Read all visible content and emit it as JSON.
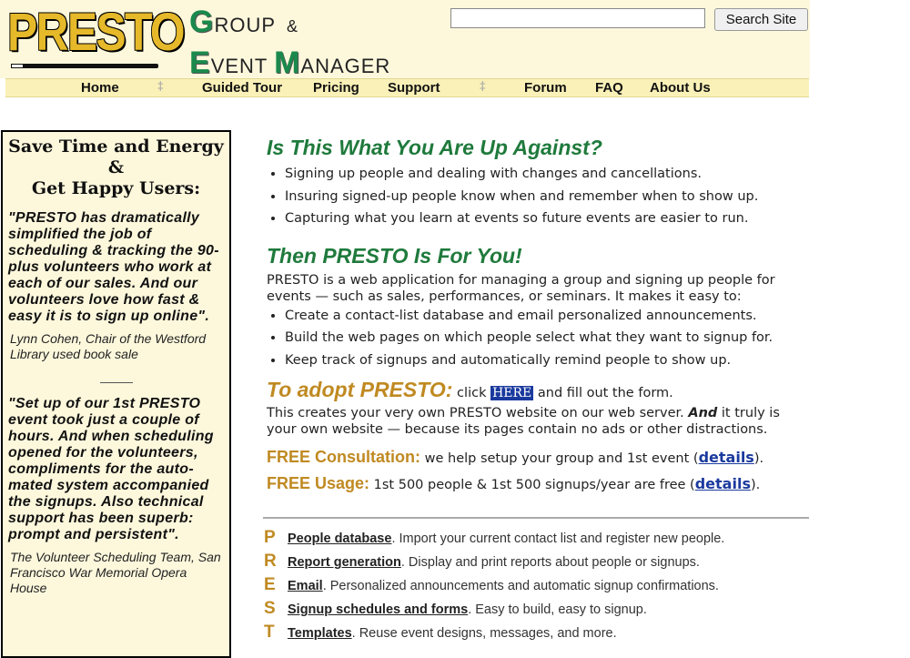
{
  "header": {
    "logo_text": "PRESTO",
    "tagline": [
      {
        "cap": "G",
        "rest": "ROUP",
        "amp": "&"
      },
      {
        "cap": "E",
        "rest": "VENT ",
        "cap2": "M",
        "rest2": "ANAGER"
      }
    ],
    "search_placeholder": "",
    "search_button": "Search Site"
  },
  "nav": [
    {
      "label": "Home"
    },
    {
      "label": "Guided Tour"
    },
    {
      "label": "Pricing"
    },
    {
      "label": "Support"
    },
    {
      "label": "Forum"
    },
    {
      "label": "FAQ"
    },
    {
      "label": "About Us"
    }
  ],
  "nav_separator": "‡",
  "sidebar": {
    "heading_line1": "Save Time and Energy",
    "heading_line2": "&",
    "heading_line3": "Get Happy Users:",
    "quote1": "\"PRESTO has dramatically simplified the job of scheduling & tracking the 90-plus volunteers who work at each of our sales. And our volunteers love how fast & easy it is to sign up online\".",
    "attrib1": "Lynn Cohen, Chair of the Westford Library used book sale",
    "quote2": "\"Set up of our 1st PRESTO event took just a couple of hours. And when scheduling opened for the volunteers, compliments for the auto-mated system accompanied the signups. Also technical support has been superb: prompt and persistent\".",
    "attrib2": "The Volunteer Scheduling Team, San Francisco War Memorial Opera House"
  },
  "main": {
    "h_against": "Is This What You Are Up Against?",
    "against_items": [
      "Signing up people and dealing with changes and cancellations.",
      "Insuring signed-up people know when and remember when to show up.",
      "Capturing what you learn at events so future events are easier to run."
    ],
    "h_foryou": "Then PRESTO Is For You!",
    "intro": "PRESTO is a web application for managing a group and signing up people for events — such as sales, performances, or seminars. It makes it easy to:",
    "foryou_items": [
      "Create a contact-list database and email personalized announcements.",
      "Build the web pages on which people select what they want to signup for.",
      "Keep track of signups and automatically remind people to show up."
    ],
    "adopt_heading": "To adopt PRESTO:",
    "adopt_click": " click ",
    "adopt_here": "HERE",
    "adopt_rest": " and fill out the form.",
    "adopt_para_1": "This creates your very own PRESTO website on our web server. ",
    "adopt_para_and": "And",
    "adopt_para_2": " it truly is your own website — because its pages contain no ads or other distractions.",
    "consult_heading": "FREE Consultation:",
    "consult_text": " we help setup your group and 1st event (",
    "usage_heading": "FREE Usage:",
    "usage_text": " 1st 500 people & 1st 500 signups/year are free (",
    "details_label": "details",
    "close_paren": ")."
  },
  "features": [
    {
      "letter": "P",
      "link": "People database",
      "desc": ". Import your current contact list and register new people."
    },
    {
      "letter": "R",
      "link": "Report generation",
      "desc": ". Display and print reports about people or signups."
    },
    {
      "letter": "E",
      "link": "Email",
      "desc": ". Personalized announcements and automatic signup confirmations."
    },
    {
      "letter": "S",
      "link": "Signup schedules and forms",
      "desc": ". Easy to build, easy to signup."
    },
    {
      "letter": "T",
      "link": "Templates",
      "desc": ". Reuse event designs, messages, and more."
    }
  ]
}
